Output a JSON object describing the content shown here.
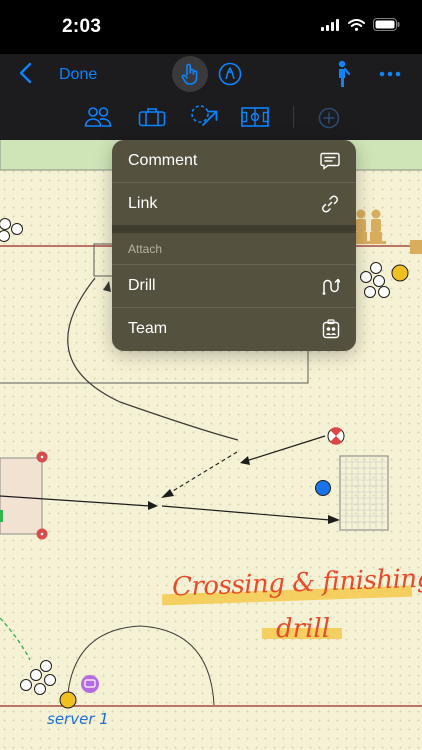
{
  "status_bar": {
    "time": "2:03"
  },
  "toolbar": {
    "done_label": "Done"
  },
  "menu": {
    "items": [
      {
        "label": "Comment",
        "icon": "comment-icon"
      },
      {
        "label": "Link",
        "icon": "link-icon"
      }
    ],
    "section_title": "Attach",
    "attach_items": [
      {
        "label": "Drill",
        "icon": "drill-icon"
      },
      {
        "label": "Team",
        "icon": "team-icon"
      }
    ]
  },
  "canvas": {
    "annotation_line1": "Crossing & finishing",
    "annotation_line2": "drill",
    "server_label": "server 1"
  },
  "colors": {
    "accent": "#0a84ff",
    "annotation": "#e94a2a",
    "highlight": "#f5c94a",
    "field_line": "#9b2b26"
  }
}
